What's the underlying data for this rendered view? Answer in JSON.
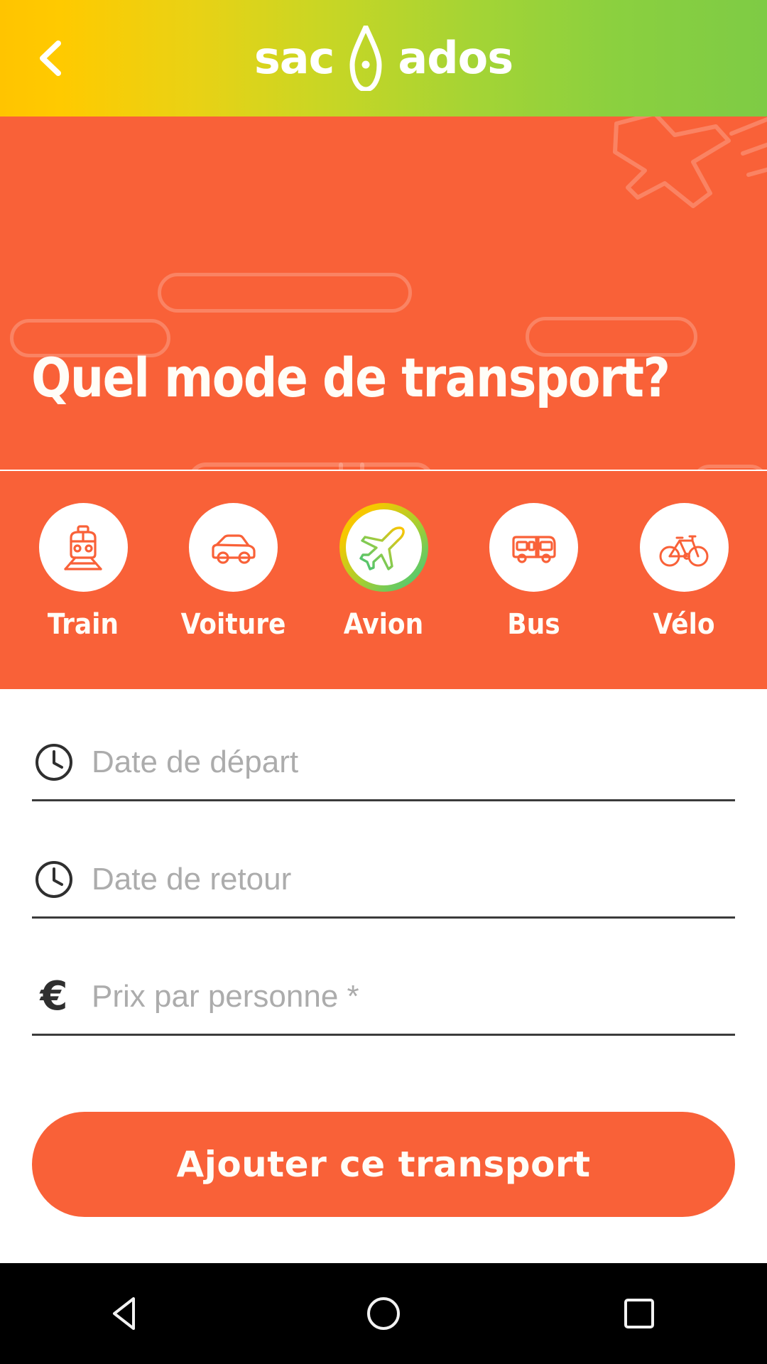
{
  "header": {
    "back_icon": "chevron-left-icon",
    "brand_left": "sac",
    "brand_right": "ados",
    "pin_icon": "map-pin-icon",
    "gradient_start": "#FFC400",
    "gradient_end": "#7ECB45"
  },
  "hero": {
    "title": "Quel mode de transport?",
    "background_color": "#F96138",
    "decorations": [
      "plane-line-art",
      "bus-line-art",
      "pill-shapes",
      "speed-lines"
    ]
  },
  "modes": {
    "accent_color": "#F96138",
    "selected_ring_gradient": [
      "#FFC400",
      "#4CC77B"
    ],
    "items": [
      {
        "id": "train",
        "label": "Train",
        "icon": "train-icon",
        "selected": false
      },
      {
        "id": "voiture",
        "label": "Voiture",
        "icon": "car-icon",
        "selected": false
      },
      {
        "id": "avion",
        "label": "Avion",
        "icon": "airplane-icon",
        "selected": true
      },
      {
        "id": "bus",
        "label": "Bus",
        "icon": "bus-icon",
        "selected": false
      },
      {
        "id": "velo",
        "label": "Vélo",
        "icon": "bicycle-icon",
        "selected": false
      }
    ]
  },
  "form": {
    "fields": [
      {
        "id": "date-depart",
        "icon": "clock-icon",
        "placeholder": "Date de départ",
        "value": ""
      },
      {
        "id": "date-retour",
        "icon": "clock-icon",
        "placeholder": "Date de retour",
        "value": ""
      },
      {
        "id": "prix",
        "icon": "euro-icon",
        "placeholder": "Prix par personne *",
        "value": ""
      }
    ],
    "submit_label": "Ajouter ce transport",
    "submit_color": "#F96138"
  },
  "navbar": {
    "back_label": "back-nav",
    "home_label": "home-nav",
    "recents_label": "recents-nav",
    "background": "#000000"
  }
}
